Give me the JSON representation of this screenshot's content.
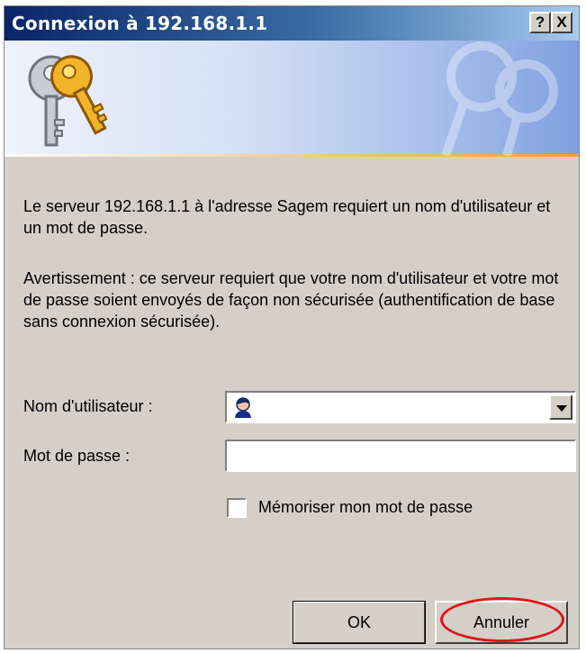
{
  "window": {
    "title": "Connexion à 192.168.1.1",
    "help_label": "?",
    "close_label": "X"
  },
  "banner": {
    "icon": "keys-icon",
    "watermark": "keys-watermark-icon"
  },
  "message": {
    "line1": "Le serveur 192.168.1.1 à l'adresse Sagem requiert un nom d'utilisateur et un mot de passe.",
    "warning": "Avertissement : ce serveur requiert que votre nom d'utilisateur et votre mot de passe soient envoyés de façon non sécurisée (authentification de base sans connexion sécurisée)."
  },
  "form": {
    "username_label": "Nom d'utilisateur :",
    "username_value": "",
    "password_label": "Mot de passe :",
    "password_value": "",
    "remember_label": "Mémoriser mon mot de passe",
    "remember_checked": false
  },
  "buttons": {
    "ok_label": "OK",
    "cancel_label": "Annuler"
  },
  "colors": {
    "titlebar": "#0a246a",
    "dialog_bg": "#d4d0c8",
    "highlight": "#e0141c"
  }
}
